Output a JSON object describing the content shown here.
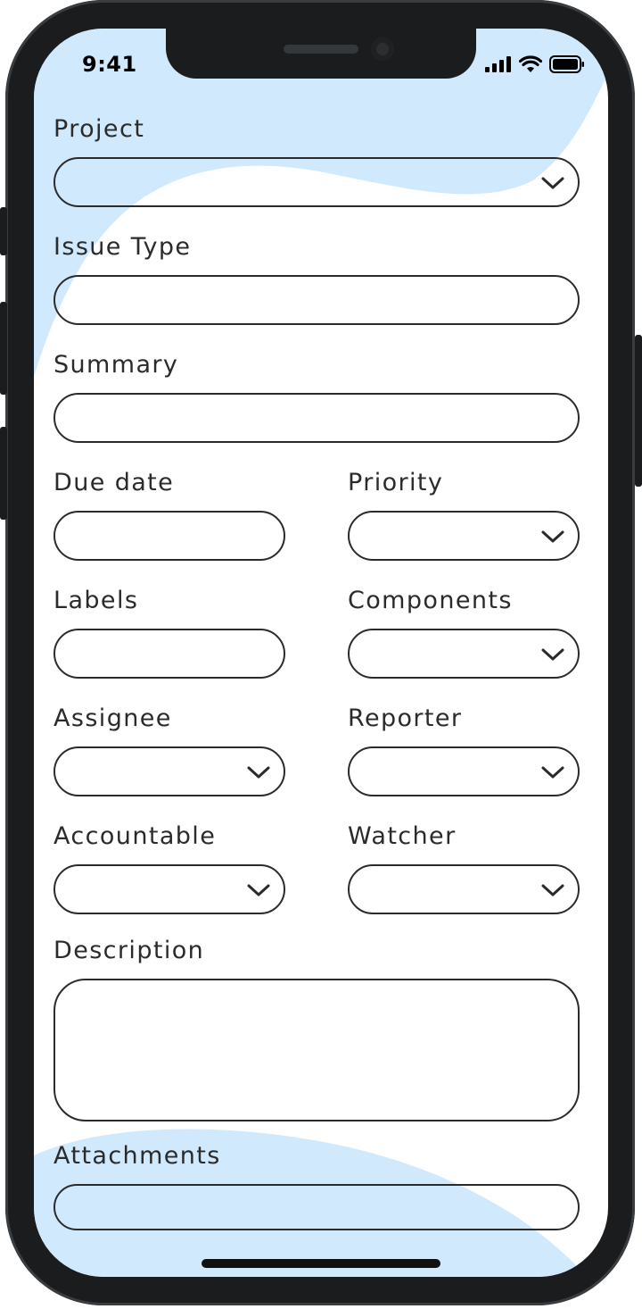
{
  "status_bar": {
    "time": "9:41"
  },
  "form": {
    "project_label": "Project",
    "issue_type_label": "Issue Type",
    "summary_label": "Summary",
    "due_date_label": "Due date",
    "priority_label": "Priority",
    "labels_label": "Labels",
    "components_label": "Components",
    "assignee_label": "Assignee",
    "reporter_label": "Reporter",
    "accountable_label": "Accountable",
    "watcher_label": "Watcher",
    "description_label": "Description",
    "attachments_label": "Attachments"
  },
  "colors": {
    "accent_wave": "#d0e9fc",
    "outline": "#2b2b2b",
    "frame": "#1a1c1e"
  },
  "icons": {
    "dropdown": "chevron-down-icon",
    "signal": "signal-icon",
    "wifi": "wifi-icon",
    "battery": "battery-icon"
  }
}
